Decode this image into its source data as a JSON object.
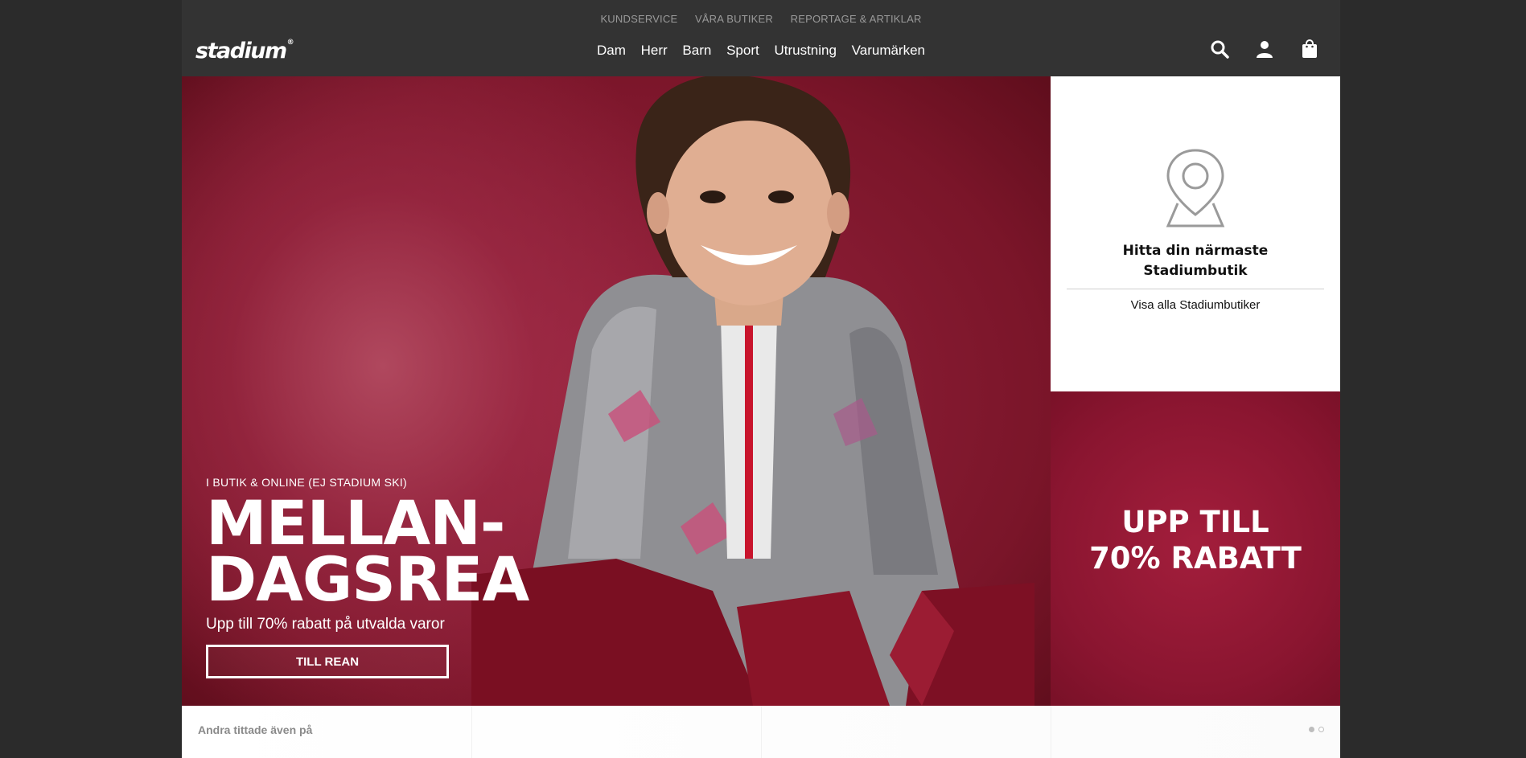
{
  "header": {
    "utility_links": [
      "KUNDSERVICE",
      "VÅRA BUTIKER",
      "REPORTAGE & ARTIKLAR"
    ],
    "logo_text": "stadium",
    "logo_mark": "®",
    "main_nav": [
      "Dam",
      "Herr",
      "Barn",
      "Sport",
      "Utrustning",
      "Varumärken"
    ],
    "icons": [
      "search-icon",
      "user-icon",
      "bag-icon"
    ]
  },
  "hero": {
    "eyebrow": "I BUTIK & ONLINE (EJ STADIUM SKI)",
    "headline_line1": "MELLAN-",
    "headline_line2": "DAGSREA",
    "subtitle": "Upp till 70% rabatt på utvalda varor",
    "cta_label": "TILL REAN"
  },
  "store_card": {
    "title_line1": "Hitta din närmaste",
    "title_line2": "Stadiumbutik",
    "link_label": "Visa alla Stadiumbutiker",
    "icon": "map-pin-icon"
  },
  "promo": {
    "line1": "UPP TILL",
    "line2": "70% RABATT"
  },
  "bottom_bar": {
    "label": "Andra tittade även på",
    "carousel_pages": 2,
    "active_page": 1
  },
  "colors": {
    "header_bg": "#333333",
    "hero_red": "#8a1530",
    "text_white": "#ffffff"
  }
}
